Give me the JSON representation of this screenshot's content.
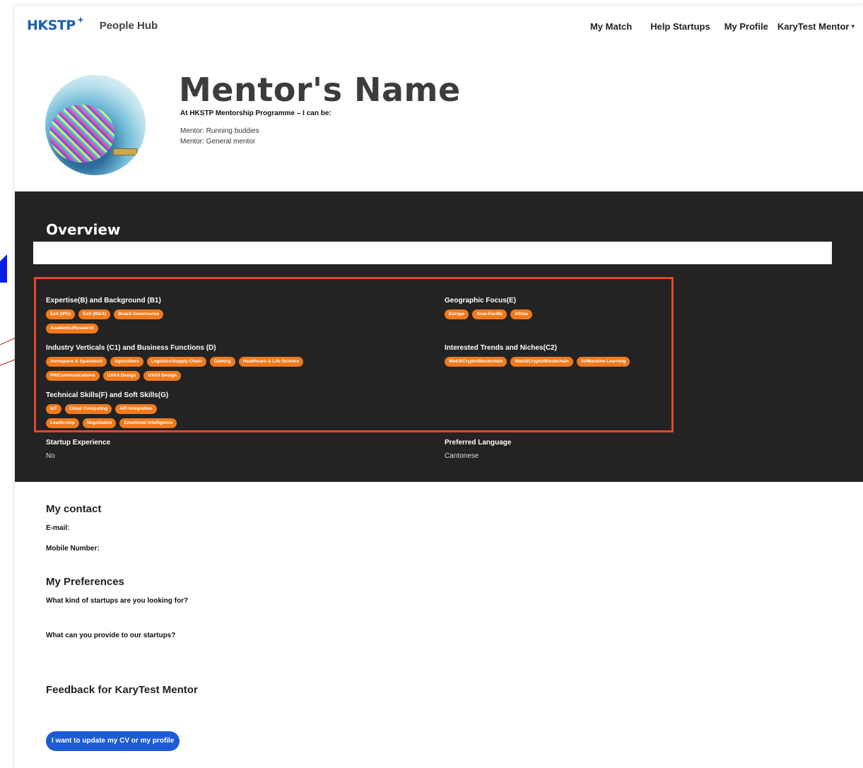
{
  "nav": {
    "logo_mark": "HKSTP",
    "app_name": "People Hub",
    "links": [
      "My Match",
      "Help Startups",
      "My Profile"
    ],
    "user_menu": "KaryTest Mentor"
  },
  "profile": {
    "name": "Mentor's Name",
    "programme": "At HKSTP Mentorship Programme – I can be:",
    "roles": [
      "Mentor: Running buddies",
      "Mentor: General mentor"
    ]
  },
  "overview": {
    "title": "Overview",
    "expertise": {
      "title": "Expertise(B) and Background (B1)",
      "row1": [
        "Exit (IPO)",
        "Exit (M&A)",
        "Board Governance"
      ],
      "row2": [
        "Academic/Research"
      ]
    },
    "geographic": {
      "title": "Geographic Focus(E)",
      "row1": [
        "Europe",
        "Asia-Pacific",
        "Africa"
      ]
    },
    "industry": {
      "title": "Industry Verticals (C1) and Business Functions (D)",
      "row1": [
        "Aerospace & Spacetech",
        "Agriculture",
        "Logistics/Supply Chain",
        "Gaming",
        "Healthcare & Life Science"
      ],
      "row2": [
        "PR/Communications",
        "UX/UI Design",
        "UX/UI Design"
      ]
    },
    "trends": {
      "title": "Interested Trends and Niches(C2)",
      "row1": [
        "Web3/Crypto/Blockchain",
        "Web3/Crypto/Blockchain",
        "AI/Machine Learning"
      ]
    },
    "skills": {
      "title": "Technical Skills(F) and Soft Skills(G)",
      "row1": [
        "IoT",
        "Cloud Computing",
        "API Integration"
      ],
      "row2": [
        "Leadership",
        "Negotiation",
        "Emotional Intelligence"
      ]
    },
    "startup_experience": {
      "label": "Startup Experience",
      "value": "No"
    },
    "preferred_language": {
      "label": "Preferred Language",
      "value": "Cantonese"
    }
  },
  "contact": {
    "title": "My contact",
    "email_label": "E-mail:",
    "mobile_label": "Mobile Number:"
  },
  "preferences": {
    "title": "My Preferences",
    "q1": "What kind of startups are you looking for?",
    "q2": "What can you provide to our startups?"
  },
  "feedback": {
    "title": "Feedback for KaryTest Mentor"
  },
  "actions": {
    "update_label": "I want to update my CV or my profile"
  },
  "colors": {
    "tag": "#f07a1d",
    "dark_band": "#232323",
    "button": "#1e5ad6",
    "highlight": "#e2472d",
    "logo": "#1a5fb4"
  }
}
